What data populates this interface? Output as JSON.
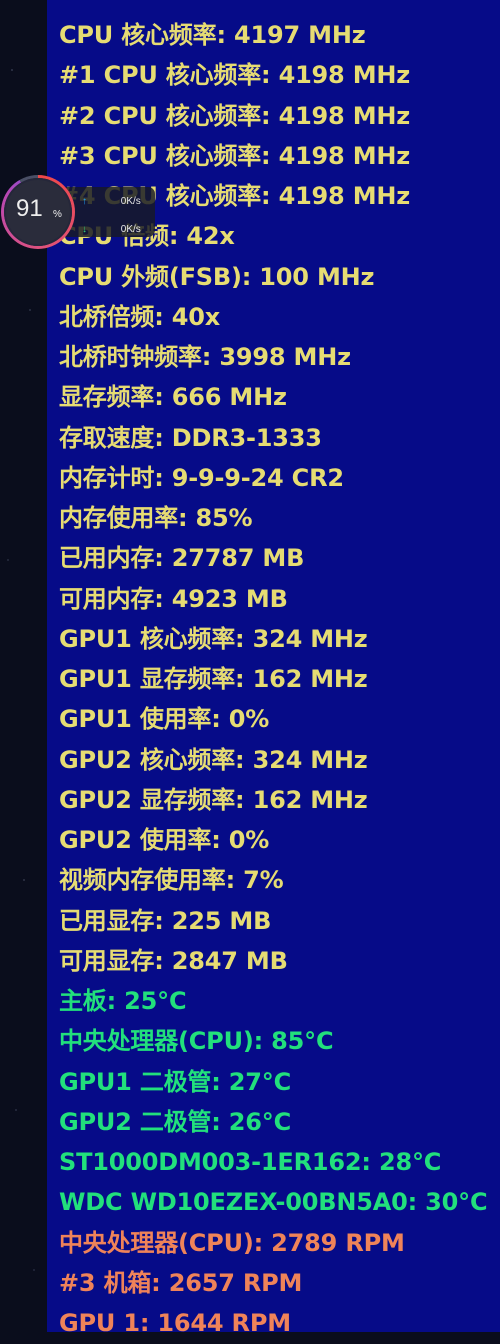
{
  "widget": {
    "memory_percent": "91",
    "memory_unit": "%",
    "upload_speed": "0K/s",
    "download_speed": "0K/s",
    "upload_arrow": "↑",
    "download_arrow": "↓"
  },
  "rows": [
    {
      "text": "CPU 核心频率: 4197 MHz",
      "group": "info"
    },
    {
      "text": "#1 CPU 核心频率: 4198 MHz",
      "group": "info"
    },
    {
      "text": "#2 CPU 核心频率: 4198 MHz",
      "group": "info"
    },
    {
      "text": "#3 CPU 核心频率: 4198 MHz",
      "group": "info"
    },
    {
      "text": "#4 CPU 核心频率: 4198 MHz",
      "group": "info"
    },
    {
      "text": "CPU 倍频: 42x",
      "group": "info"
    },
    {
      "text": "CPU 外频(FSB): 100 MHz",
      "group": "info"
    },
    {
      "text": "北桥倍频: 40x",
      "group": "info"
    },
    {
      "text": "北桥时钟频率: 3998 MHz",
      "group": "info"
    },
    {
      "text": "显存频率: 666 MHz",
      "group": "info"
    },
    {
      "text": "存取速度: DDR3-1333",
      "group": "info"
    },
    {
      "text": "内存计时: 9-9-9-24 CR2",
      "group": "info"
    },
    {
      "text": "内存使用率: 85%",
      "group": "info"
    },
    {
      "text": "已用内存: 27787 MB",
      "group": "info"
    },
    {
      "text": "可用内存: 4923 MB",
      "group": "info"
    },
    {
      "text": "GPU1 核心频率: 324 MHz",
      "group": "info"
    },
    {
      "text": "GPU1 显存频率: 162 MHz",
      "group": "info"
    },
    {
      "text": "GPU1 使用率: 0%",
      "group": "info"
    },
    {
      "text": "GPU2 核心频率: 324 MHz",
      "group": "info"
    },
    {
      "text": "GPU2 显存频率: 162 MHz",
      "group": "info"
    },
    {
      "text": "GPU2 使用率: 0%",
      "group": "info"
    },
    {
      "text": "视频内存使用率: 7%",
      "group": "info"
    },
    {
      "text": "已用显存: 225 MB",
      "group": "info"
    },
    {
      "text": "可用显存: 2847 MB",
      "group": "info"
    },
    {
      "text": "主板: 25°C",
      "group": "temp"
    },
    {
      "text": "中央处理器(CPU): 85°C",
      "group": "temp"
    },
    {
      "text": "GPU1 二极管: 27°C",
      "group": "temp"
    },
    {
      "text": "GPU2 二极管: 26°C",
      "group": "temp"
    },
    {
      "text": "ST1000DM003-1ER162: 28°C",
      "group": "temp"
    },
    {
      "text": "WDC WD10EZEX-00BN5A0: 30°C",
      "group": "temp"
    },
    {
      "text": "中央处理器(CPU): 2789 RPM",
      "group": "fan"
    },
    {
      "text": "#3 机箱: 2657 RPM",
      "group": "fan"
    },
    {
      "text": "GPU 1: 1644 RPM",
      "group": "fan"
    }
  ]
}
